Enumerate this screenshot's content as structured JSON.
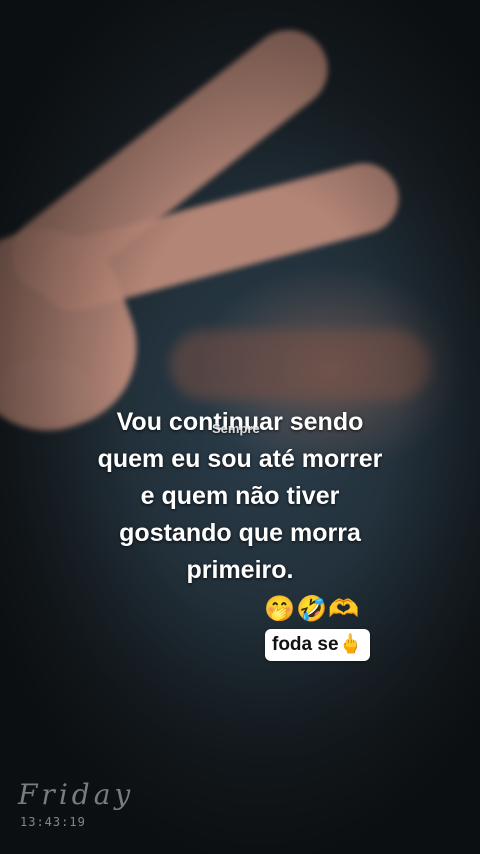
{
  "caption": {
    "lines": [
      "Vou continuar sendo",
      "quem eu sou até morrer",
      "e quem não tiver",
      "gostando que morra",
      "primeiro."
    ],
    "overlay_text": "Sempre"
  },
  "reaction": {
    "emojis": "🤭🤣🫶",
    "sticker_text": "foda se🖕"
  },
  "widget": {
    "day": "Friday",
    "time": "13:43:19"
  }
}
